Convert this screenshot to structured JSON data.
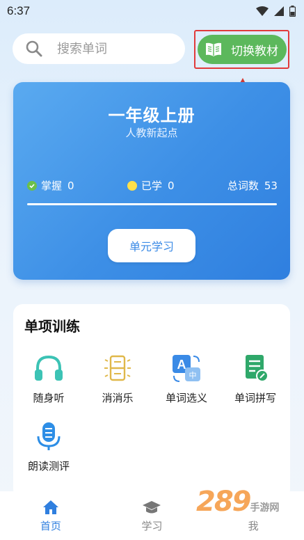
{
  "status_bar": {
    "time": "6:37"
  },
  "search": {
    "placeholder": "搜索单词"
  },
  "switch_button": {
    "label": "切换教材"
  },
  "hero": {
    "title": "一年级上册",
    "subtitle": "人教新起点",
    "stats": {
      "mastered_label": "掌握",
      "mastered_value": "0",
      "learned_label": "已学",
      "learned_value": "0",
      "total_label": "总词数",
      "total_value": "53"
    },
    "unit_button": "单元学习",
    "colors": {
      "mastered_dot": "#6cc04a",
      "learned_dot": "#ffe04a",
      "card_start": "#5aaaf0",
      "card_end": "#2f7fdf"
    }
  },
  "training": {
    "title": "单项训练",
    "items": [
      {
        "label": "随身听",
        "icon": "headphones-icon"
      },
      {
        "label": "消消乐",
        "icon": "eliminate-game-icon"
      },
      {
        "label": "单词选义",
        "icon": "translate-icon"
      },
      {
        "label": "单词拼写",
        "icon": "spelling-icon"
      },
      {
        "label": "朗读测评",
        "icon": "microphone-icon"
      }
    ]
  },
  "bottom_nav": {
    "items": [
      {
        "label": "首页",
        "icon": "home-icon",
        "active": true
      },
      {
        "label": "学习",
        "icon": "graduation-cap-icon",
        "active": false
      },
      {
        "label": "我",
        "icon": "profile-icon",
        "active": false
      }
    ]
  },
  "watermark": {
    "number": "289",
    "text": "手游网"
  },
  "accent_color": "#2f7fdf",
  "highlight_color": "#e13a3a"
}
